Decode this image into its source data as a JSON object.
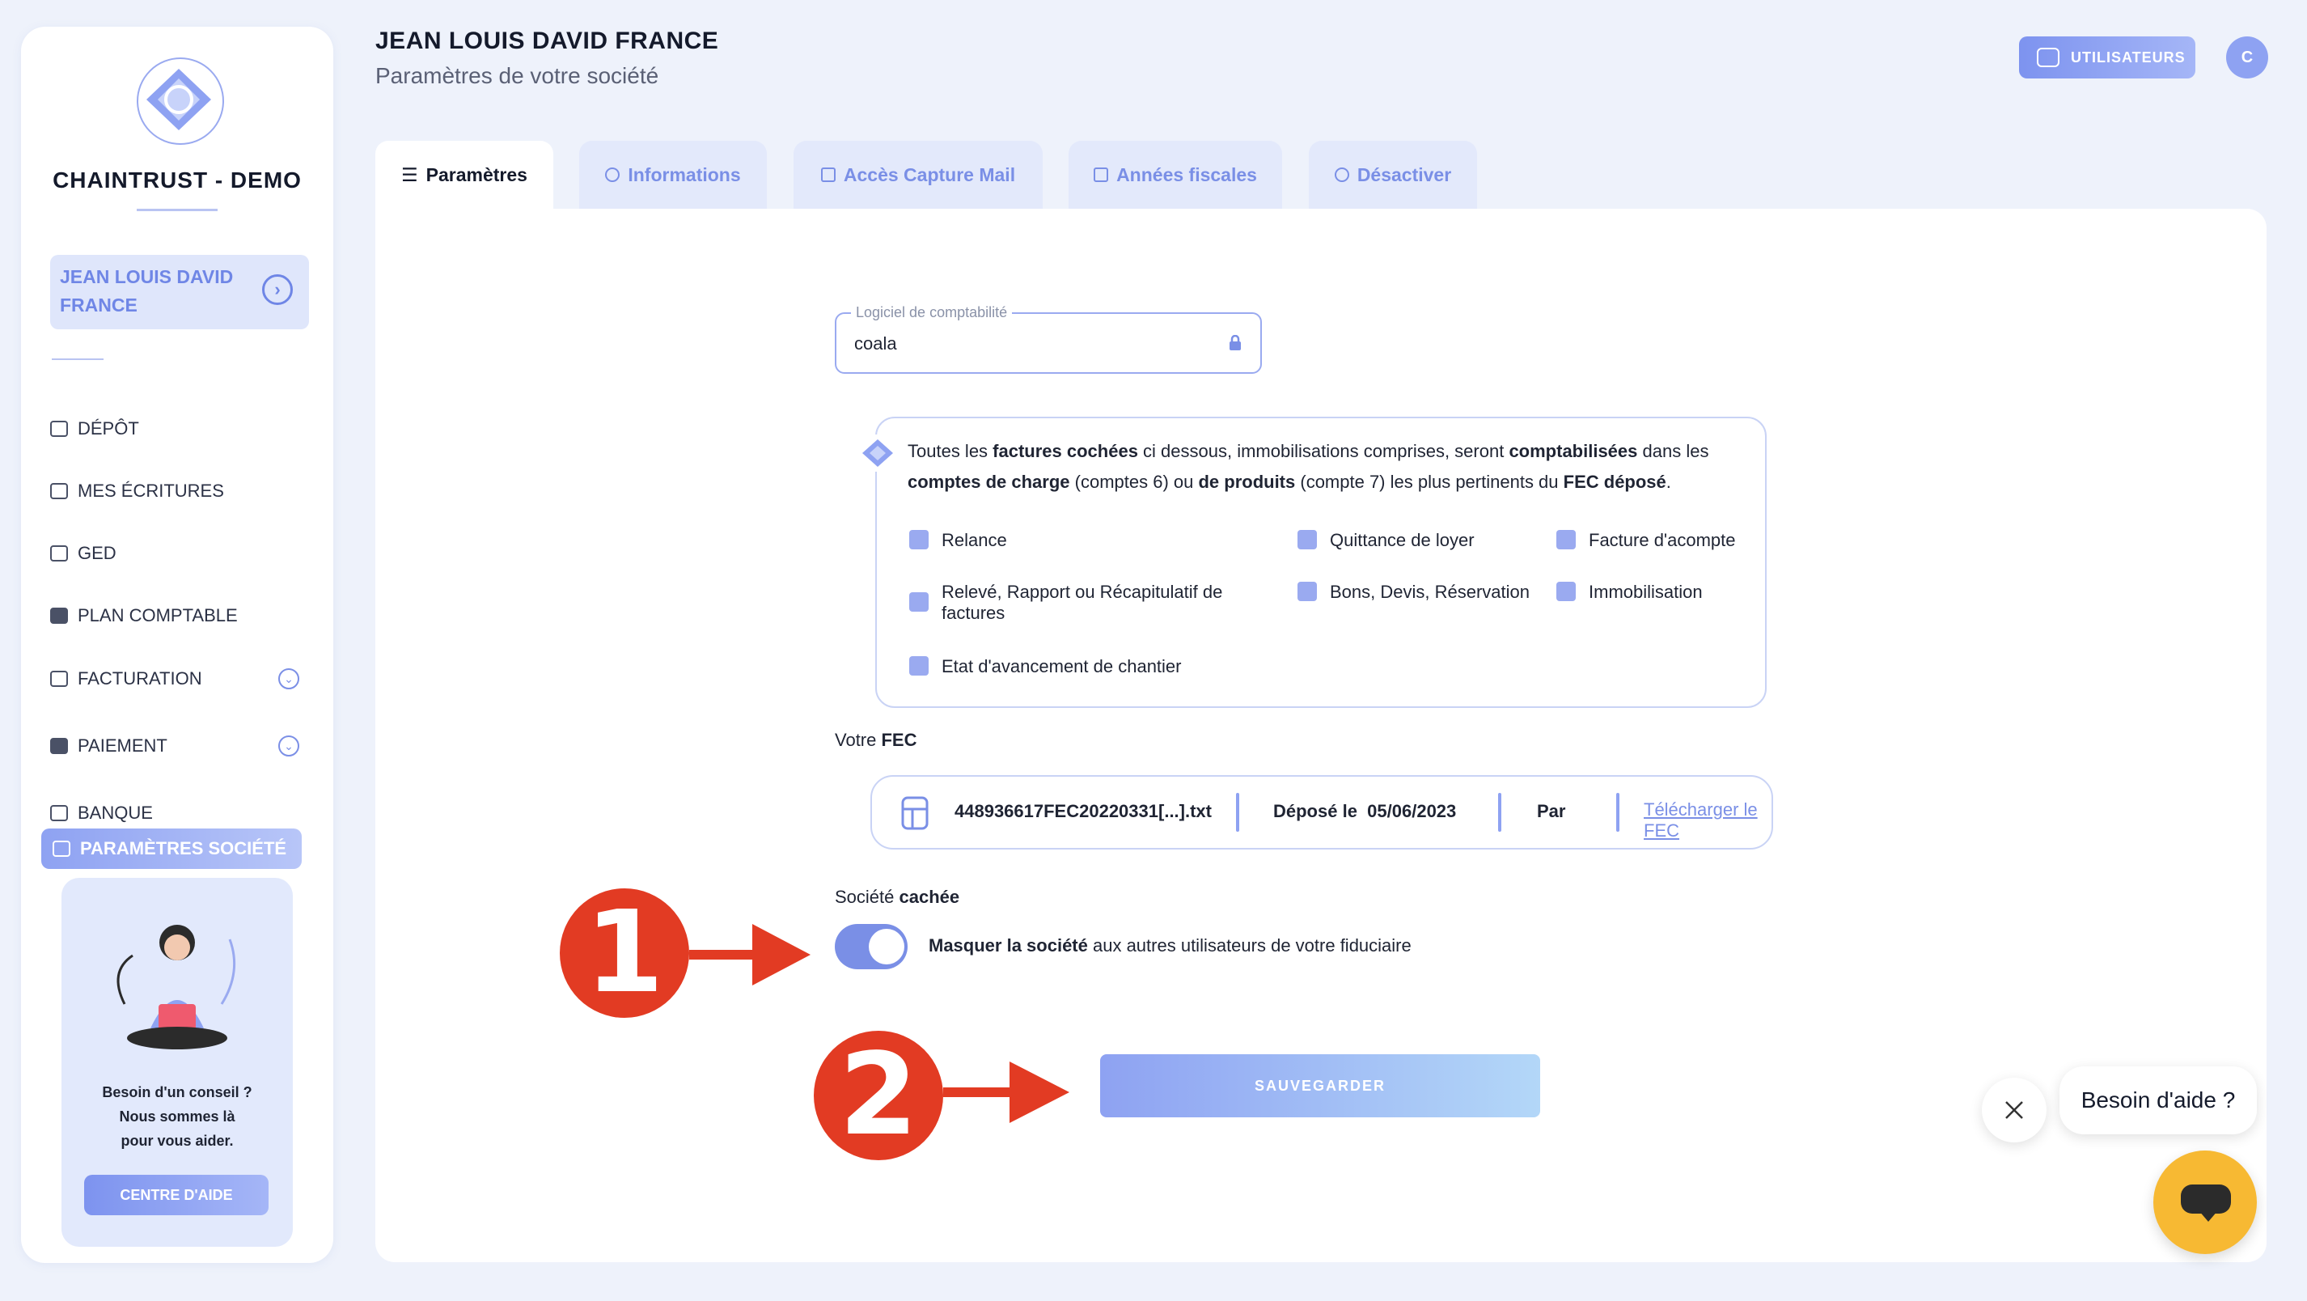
{
  "sidebar": {
    "brand": "CHAINTRUST - DEMO",
    "company_line1": "JEAN LOUIS DAVID",
    "company_line2": "FRANCE",
    "items": [
      {
        "label": "DÉPÔT"
      },
      {
        "label": "MES ÉCRITURES"
      },
      {
        "label": "GED"
      },
      {
        "label": "PLAN COMPTABLE"
      },
      {
        "label": "FACTURATION"
      },
      {
        "label": "PAIEMENT"
      },
      {
        "label": "BANQUE"
      },
      {
        "label": "PARAMÈTRES SOCIÉTÉ"
      }
    ],
    "help": {
      "line1": "Besoin d'un conseil ?",
      "line2": "Nous sommes là",
      "line3": "pour vous aider.",
      "button": "CENTRE D'AIDE"
    }
  },
  "header": {
    "title": "JEAN LOUIS DAVID FRANCE",
    "subtitle": "Paramètres de votre société",
    "users_button": "UTILISATEURS",
    "avatar_initial": "C"
  },
  "tabs": [
    {
      "label": "Paramètres"
    },
    {
      "label": "Informations"
    },
    {
      "label": "Accès Capture Mail"
    },
    {
      "label": "Années fiscales"
    },
    {
      "label": "Désactiver"
    }
  ],
  "form": {
    "software_label": "Logiciel de comptabilité",
    "software_value": "coala",
    "info": {
      "t1": "Toutes les ",
      "t2": "factures cochées",
      "t3": " ci dessous, immobilisations comprises, seront ",
      "t4": "comptabilisées",
      "t5": " dans les ",
      "t6": "comptes de charge",
      "t7": " (comptes 6) ou ",
      "t8": "de produits",
      "t9": " (compte 7) les plus pertinents du ",
      "t10": "FEC déposé",
      "t11": "."
    },
    "checkboxes": [
      "Relance",
      "Quittance de loyer",
      "Facture d'acompte",
      "Relevé, Rapport ou Récapitulatif de factures",
      "Bons, Devis, Réservation",
      "Immobilisation",
      "Etat d'avancement de chantier"
    ],
    "fec": {
      "label_prefix": "Votre ",
      "label_bold": "FEC",
      "filename": "448936617FEC20220331[...].txt",
      "deposited_label": "Déposé le",
      "deposited_date": "05/06/2023",
      "by_label": "Par",
      "download_link": "Télécharger le FEC"
    },
    "hidden": {
      "label_prefix": "Société ",
      "label_bold": "cachée",
      "toggle_bold": "Masquer la société",
      "toggle_rest": " aux autres utilisateurs de votre fiduciaire",
      "enabled": true
    },
    "save_button": "SAUVEGARDER"
  },
  "annotations": {
    "marker1": "1",
    "marker2": "2"
  },
  "help_widget": {
    "bubble": "Besoin d'aide ?"
  },
  "colors": {
    "accent": "#7a8fe6",
    "marker": "#e23b23",
    "chat": "#f7b933"
  }
}
